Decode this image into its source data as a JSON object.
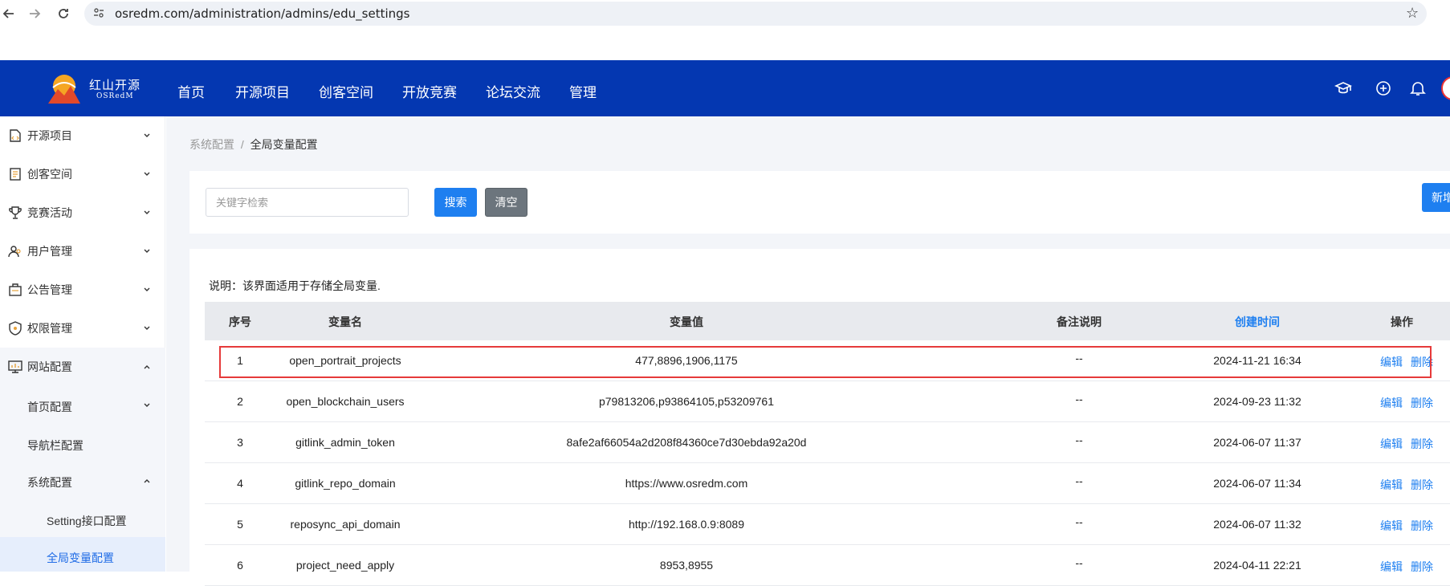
{
  "browser": {
    "url": "osredm.com/administration/admins/edu_settings"
  },
  "brand": {
    "name_cn": "红山开源",
    "name_en": "OSRedM"
  },
  "topnav": {
    "items": [
      "首页",
      "开源项目",
      "创客空间",
      "开放竞赛",
      "论坛交流",
      "管理"
    ]
  },
  "sidebar": {
    "items": [
      {
        "label": "开源项目",
        "icon": "project-icon"
      },
      {
        "label": "创客空间",
        "icon": "maker-icon"
      },
      {
        "label": "竞赛活动",
        "icon": "trophy-icon"
      },
      {
        "label": "用户管理",
        "icon": "users-icon"
      },
      {
        "label": "公告管理",
        "icon": "announcement-icon"
      },
      {
        "label": "权限管理",
        "icon": "shield-icon"
      },
      {
        "label": "网站配置",
        "icon": "monitor-icon"
      }
    ],
    "sub_items": [
      "首页配置",
      "导航栏配置",
      "系统配置"
    ],
    "sub_sub_items": [
      "Setting接口配置",
      "全局变量配置"
    ]
  },
  "breadcrumb": {
    "parent": "系统配置",
    "separator": "/",
    "current": "全局变量配置"
  },
  "filter": {
    "search_placeholder": "关键字检索",
    "search_button": "搜索",
    "clear_button": "清空",
    "new_button": "新增"
  },
  "note": "说明：该界面适用于存储全局变量.",
  "table": {
    "headers": {
      "index": "序号",
      "name": "变量名",
      "value": "变量值",
      "remark": "备注说明",
      "created": "创建时间",
      "actions": "操作"
    },
    "edit_label": "编辑",
    "delete_label": "删除",
    "rows": [
      {
        "index": "1",
        "name": "open_portrait_projects",
        "value": "477,8896,1906,1175",
        "remark": "--",
        "created": "2024-11-21 16:34"
      },
      {
        "index": "2",
        "name": "open_blockchain_users",
        "value": "p79813206,p93864105,p53209761",
        "remark": "--",
        "created": "2024-09-23 11:32"
      },
      {
        "index": "3",
        "name": "gitlink_admin_token",
        "value": "8afe2af66054a2d208f84360ce7d30ebda92a20d",
        "remark": "--",
        "created": "2024-06-07 11:37"
      },
      {
        "index": "4",
        "name": "gitlink_repo_domain",
        "value": "https://www.osredm.com",
        "remark": "--",
        "created": "2024-06-07 11:34"
      },
      {
        "index": "5",
        "name": "reposync_api_domain",
        "value": "http://192.168.0.9:8089",
        "remark": "--",
        "created": "2024-06-07 11:32"
      },
      {
        "index": "6",
        "name": "project_need_apply",
        "value": "8953,8955",
        "remark": "--",
        "created": "2024-04-11 22:21"
      }
    ]
  }
}
